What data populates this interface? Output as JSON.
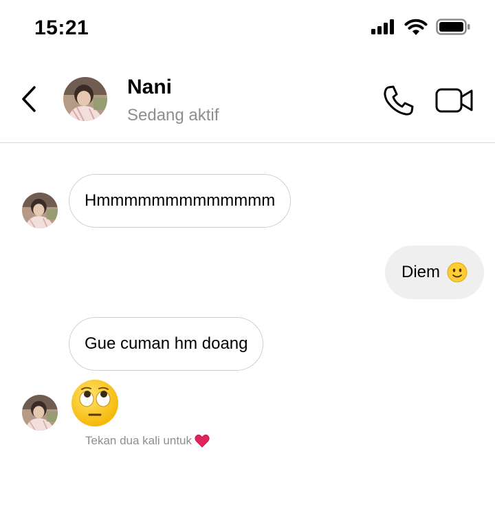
{
  "status_bar": {
    "time": "15:21",
    "icons": [
      "cellular-signal-icon",
      "wifi-icon",
      "battery-icon"
    ]
  },
  "header": {
    "contact_name": "Nani",
    "contact_status": "Sedang aktif",
    "icons": [
      "back-chevron-icon",
      "phone-icon",
      "video-camera-icon"
    ]
  },
  "messages": [
    {
      "direction": "incoming",
      "text": "Hmmmmmmmmmmmmm"
    },
    {
      "direction": "outgoing",
      "text": "Diem",
      "emoji": "slightly-smiling-face"
    },
    {
      "direction": "incoming",
      "text": "Gue cuman hm doang"
    },
    {
      "direction": "incoming",
      "emoji": "face-with-rolling-eyes"
    }
  ],
  "hint": {
    "text": "Tekan dua kali untuk",
    "icon": "red-heart-icon"
  },
  "colors": {
    "secondary_text": "#8e8e8e",
    "outgoing_bubble": "#efefef",
    "incoming_border": "#cfcfcf",
    "heart": "#e0245e"
  }
}
